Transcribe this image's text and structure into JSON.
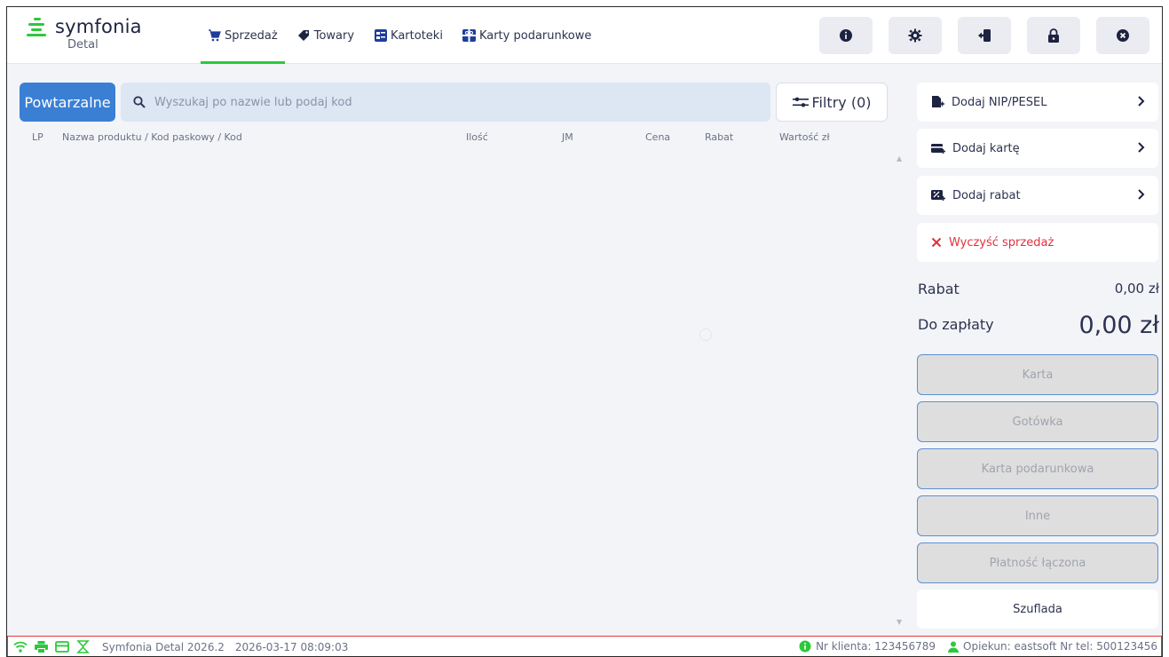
{
  "header": {
    "logo_name": "symfonia",
    "logo_sub": "Detal",
    "nav": [
      {
        "label": "Sprzedaż",
        "icon": "cart-icon",
        "active": true
      },
      {
        "label": "Towary",
        "icon": "tag-icon",
        "active": false
      },
      {
        "label": "Kartoteki",
        "icon": "contacts-icon",
        "active": false
      },
      {
        "label": "Karty podarunkowe",
        "icon": "gift-card-icon",
        "active": false
      }
    ],
    "actions": [
      "info-icon",
      "gear-icon",
      "logout-icon",
      "lock-icon",
      "close-circle-icon"
    ]
  },
  "search": {
    "repeat_label": "Powtarzalne",
    "placeholder": "Wyszukaj po nazwie lub podaj kod",
    "filter_label": "Filtry (0)"
  },
  "table": {
    "columns": [
      "LP",
      "Nazwa produktu / Kod paskowy / Kod",
      "Ilość",
      "JM",
      "Cena",
      "Rabat",
      "Wartość zł"
    ],
    "rows": []
  },
  "side": {
    "actions": [
      {
        "label": "Dodaj NIP/PESEL",
        "icon": "document-add-icon"
      },
      {
        "label": "Dodaj kartę",
        "icon": "card-add-icon"
      },
      {
        "label": "Dodaj rabat",
        "icon": "discount-icon"
      }
    ],
    "clear_label": "Wyczyść sprzedaż",
    "rabat_label": "Rabat",
    "rabat_value": "0,00 zł",
    "total_label": "Do zapłaty",
    "total_value": "0,00 zł",
    "payments": [
      "Karta",
      "Gotówka",
      "Karta podarunkowa",
      "Inne",
      "Płatność łączona"
    ],
    "drawer_label": "Szuflada"
  },
  "status": {
    "app": "Symfonia Detal 2026.2",
    "datetime": "2026-03-17 08:09:03",
    "client": "Nr klienta: 123456789",
    "keeper": "Opiekun: eastsoft Nr tel: 500123456"
  },
  "colors": {
    "accent_green": "#2dc83a",
    "primary_blue": "#3b7fd4",
    "danger_red": "#e0303c"
  }
}
